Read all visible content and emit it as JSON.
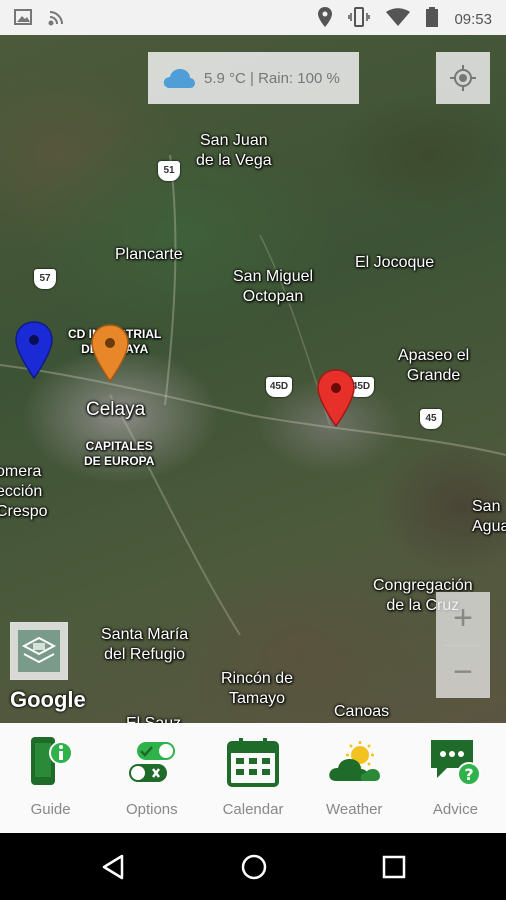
{
  "status_bar": {
    "time": "09:53",
    "left_icons": [
      "image-icon",
      "wifi-calling-icon"
    ],
    "right_icons": [
      "location-icon",
      "vibrate-icon",
      "wifi-icon",
      "battery-icon"
    ]
  },
  "map": {
    "weather": {
      "text": "5.9 °C | Rain: 100 %",
      "icon": "cloud-icon"
    },
    "labels": {
      "san_juan": "San Juan\nde la Vega",
      "plancarte": "Plancarte",
      "san_miguel": "San Miguel\nOctopan",
      "el_jocoque": "El Jocoque",
      "apaseo": "Apaseo el\nGrande",
      "celaya": "Celaya",
      "cd_industrial": "CD INDUSTRIAL\nDE CELAYA",
      "capitales": "CAPITALES\nDE EUROPA",
      "comera": "omera\nección\nCrespo",
      "san_agua": "San\nAgua",
      "congregacion": "Congregación\nde la Cruz",
      "santa_maria": "Santa María\ndel Refugio",
      "rincon": "Rincón de\nTamayo",
      "canoas": "Canoas",
      "el_sauz": "El Sauz"
    },
    "shields": {
      "s51": "51",
      "s57": "57",
      "s45d_a": "45D",
      "s45d_b": "45D",
      "s45": "45"
    },
    "pins": [
      {
        "name": "blue",
        "color": "#1a2bd6"
      },
      {
        "name": "orange",
        "color": "#e8862a"
      },
      {
        "name": "red",
        "color": "#e8302a"
      }
    ],
    "zoom_in": "+",
    "zoom_out": "−",
    "google": "Google"
  },
  "bottom_nav": [
    {
      "label": "Guide",
      "icon": "phone-info-icon"
    },
    {
      "label": "Options",
      "icon": "toggles-icon"
    },
    {
      "label": "Calendar",
      "icon": "calendar-icon"
    },
    {
      "label": "Weather",
      "icon": "sun-cloud-icon"
    },
    {
      "label": "Advice",
      "icon": "chat-help-icon"
    }
  ],
  "colors": {
    "nav_green": "#1f6b2a",
    "accent_green": "#2fb24a"
  }
}
